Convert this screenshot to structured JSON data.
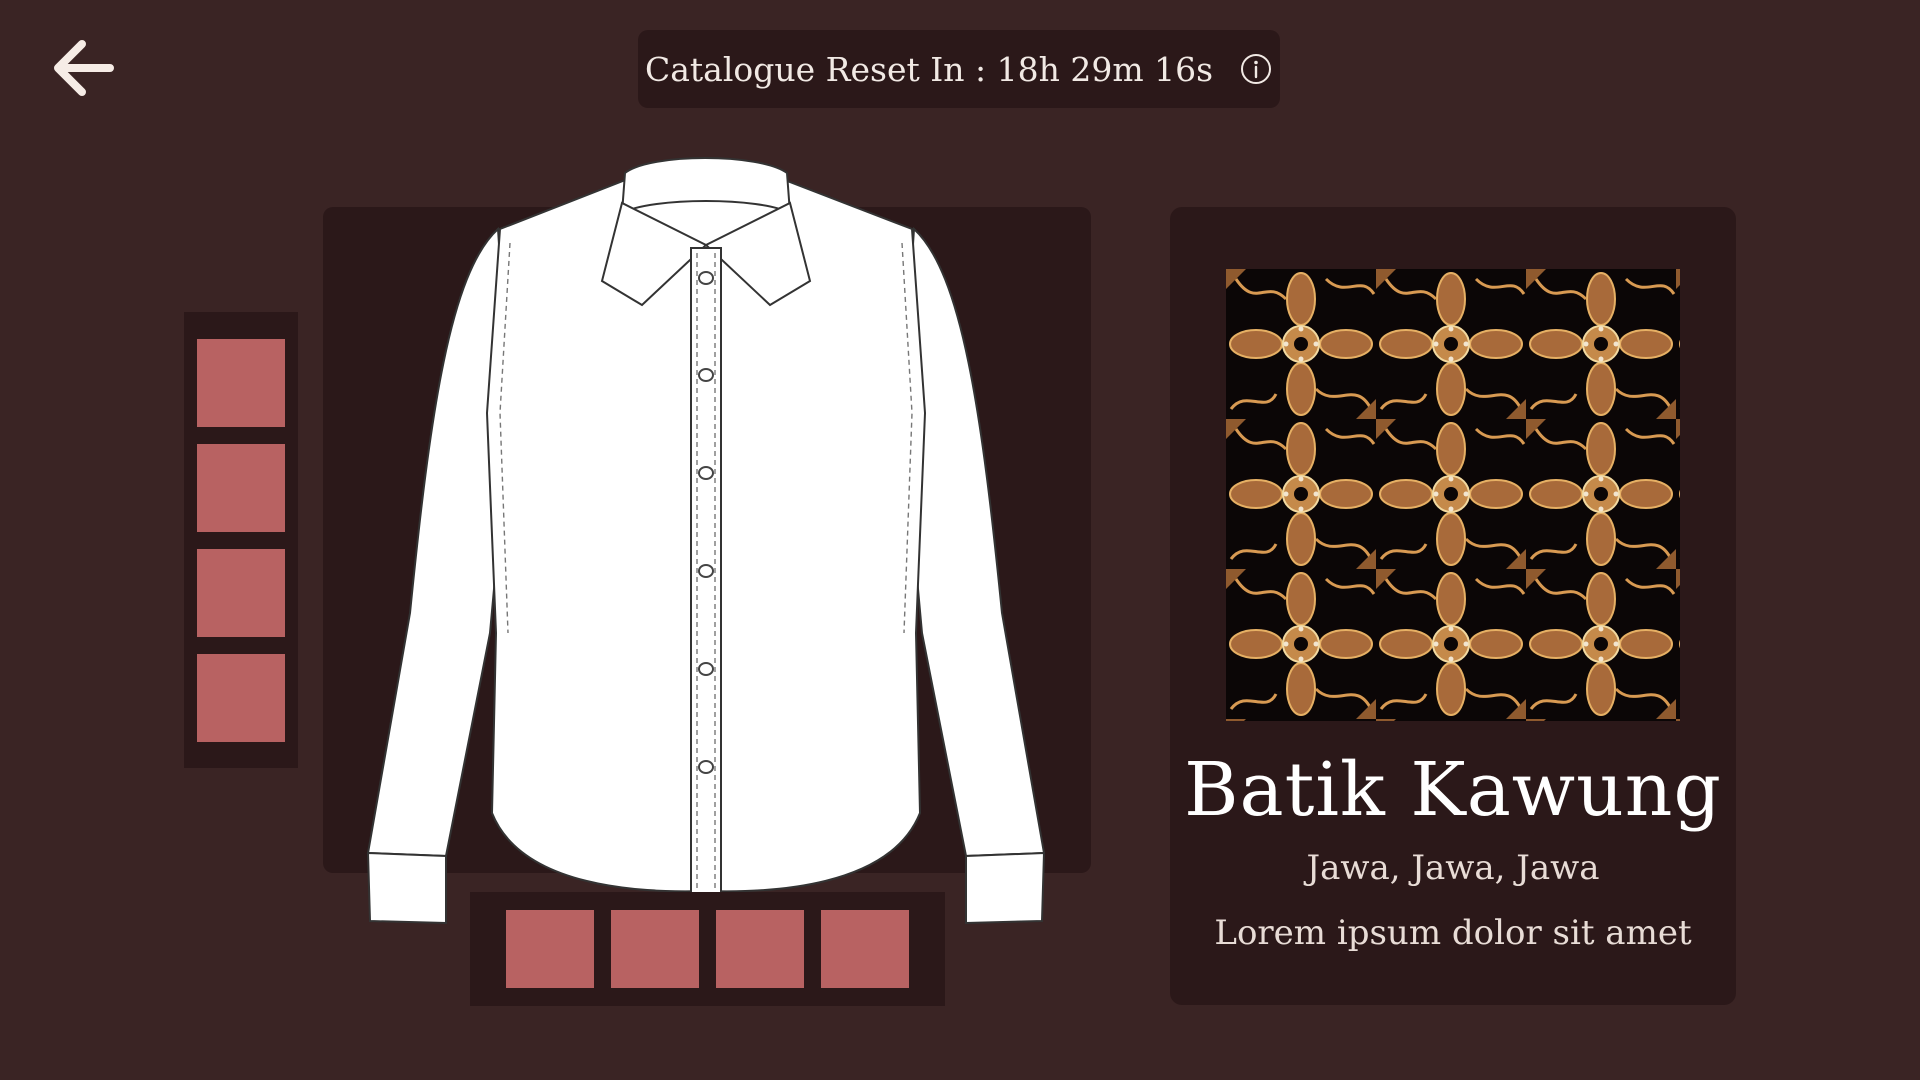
{
  "header": {
    "back_icon": "arrow-left-icon",
    "catalogue_reset_label": "Catalogue Reset In : 18h 29m 16s",
    "info_icon": "info-circle-icon"
  },
  "swatches": {
    "side_count": 4,
    "bottom_count": 4,
    "color": "#b86262"
  },
  "pattern": {
    "name": "Batik Kawung",
    "origin": "Jawa, Jawa, Jawa",
    "description": "Lorem ipsum dolor sit amet"
  },
  "colors": {
    "background": "#3a2424",
    "panel": "#2b1819",
    "swatch": "#b86262",
    "text": "#ffffff"
  }
}
